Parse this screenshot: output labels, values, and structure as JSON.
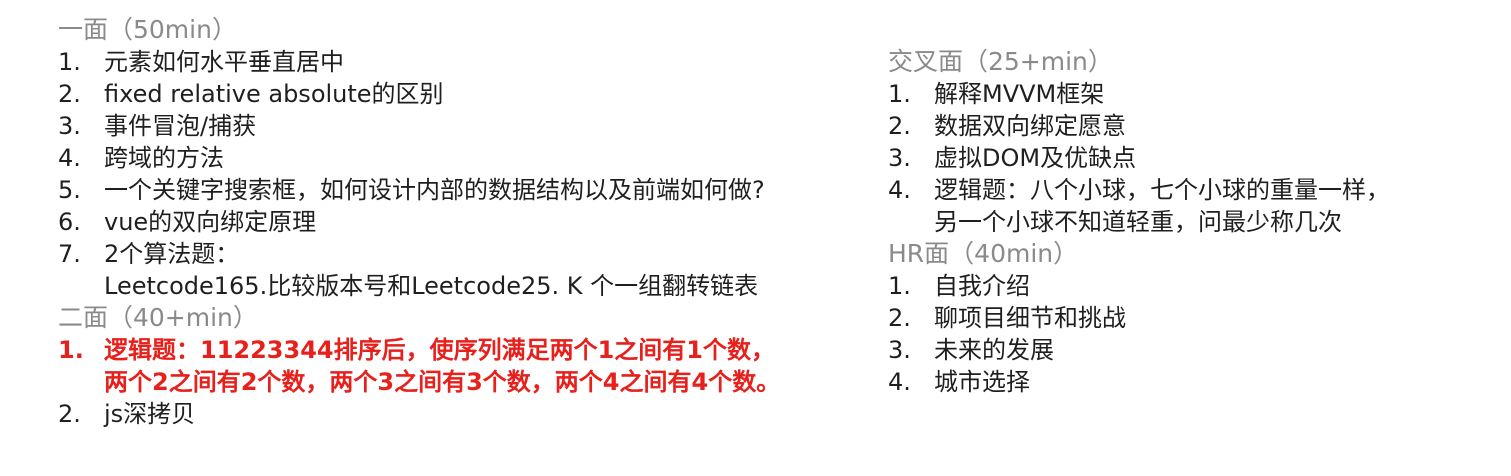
{
  "left": {
    "round1": {
      "title": "一面（50min）",
      "items": [
        {
          "num": "1.",
          "text": "元素如何水平垂直居中"
        },
        {
          "num": "2.",
          "text": "fixed relative absolute的区别"
        },
        {
          "num": "3.",
          "text": "事件冒泡/捕获"
        },
        {
          "num": "4.",
          "text": "跨域的方法"
        },
        {
          "num": "5.",
          "text": "一个关键字搜索框，如何设计内部的数据结构以及前端如何做?"
        },
        {
          "num": "6.",
          "text": "vue的双向绑定原理"
        },
        {
          "num": "7.",
          "text": "2个算法题："
        }
      ],
      "item7_cont": "Leetcode165.比较版本号和Leetcode25. K 个一组翻转链表"
    },
    "round2": {
      "title": "二面（40+min）",
      "items": [
        {
          "num": "1.",
          "text": "逻辑题：11223344排序后，使序列满足两个1之间有1个数，"
        },
        {
          "num": "2.",
          "text": "js深拷贝"
        }
      ],
      "item1_cont": "两个2之间有2个数，两个3之间有3个数，两个4之间有4个数。",
      "highlight_color": "#e8201c"
    }
  },
  "right": {
    "cross": {
      "title": "交叉面（25+min）",
      "items": [
        {
          "num": "1.",
          "text": "解释MVVM框架"
        },
        {
          "num": "2.",
          "text": "数据双向绑定愿意"
        },
        {
          "num": "3.",
          "text": "虚拟DOM及优缺点"
        },
        {
          "num": "4.",
          "text": "逻辑题：八个小球，七个小球的重量一样，"
        }
      ],
      "item4_cont": "另一个小球不知道轻重，问最少称几次"
    },
    "hr": {
      "title": "HR面（40min）",
      "items": [
        {
          "num": "1.",
          "text": "自我介绍"
        },
        {
          "num": "2.",
          "text": "聊项目细节和挑战"
        },
        {
          "num": "3.",
          "text": "未来的发展"
        },
        {
          "num": "4.",
          "text": "城市选择"
        }
      ]
    }
  }
}
